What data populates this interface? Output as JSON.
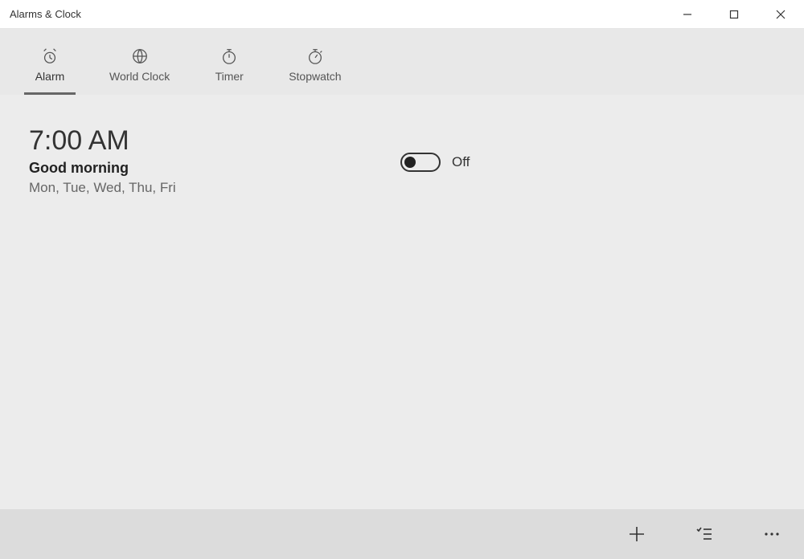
{
  "window": {
    "title": "Alarms & Clock"
  },
  "tabs": [
    {
      "label": "Alarm"
    },
    {
      "label": "World Clock"
    },
    {
      "label": "Timer"
    },
    {
      "label": "Stopwatch"
    }
  ],
  "alarms": [
    {
      "time": "7:00 AM",
      "name": "Good morning",
      "days": "Mon, Tue, Wed, Thu, Fri",
      "toggle_state_label": "Off",
      "enabled": false
    }
  ]
}
